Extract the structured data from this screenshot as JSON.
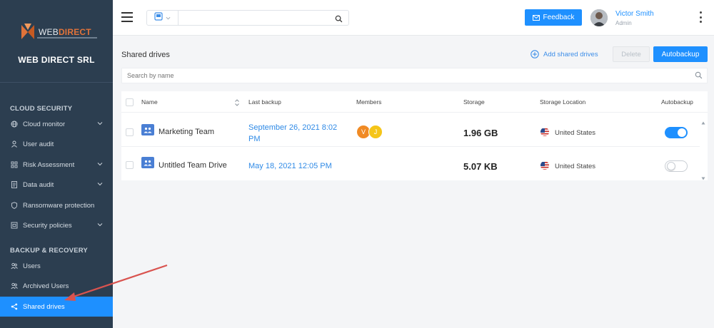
{
  "brand": {
    "logo_web": "WEB",
    "logo_direct": "DIRECT",
    "company_name": "WEB DIRECT SRL"
  },
  "sidebar": {
    "sections": [
      {
        "title": "CLOUD SECURITY"
      },
      {
        "title": "BACKUP & RECOVERY"
      }
    ],
    "items": [
      {
        "label": "Cloud monitor",
        "icon": "globe-icon",
        "has_chevron": true
      },
      {
        "label": "User audit",
        "icon": "user-icon",
        "has_chevron": false
      },
      {
        "label": "Risk Assessment",
        "icon": "grid-icon",
        "has_chevron": true
      },
      {
        "label": "Data audit",
        "icon": "document-icon",
        "has_chevron": true
      },
      {
        "label": "Ransomware protection",
        "icon": "shield-icon",
        "has_chevron": false
      },
      {
        "label": "Security policies",
        "icon": "policy-icon",
        "has_chevron": true
      },
      {
        "label": "Users",
        "icon": "users-icon",
        "has_chevron": false
      },
      {
        "label": "Archived Users",
        "icon": "archived-users-icon",
        "has_chevron": false
      },
      {
        "label": "Shared drives",
        "icon": "share-icon",
        "has_chevron": false,
        "active": true
      }
    ]
  },
  "topbar": {
    "search_placeholder": "",
    "feedback_label": "Feedback",
    "user_name": "Victor Smith",
    "user_role": "Admin"
  },
  "page": {
    "title": "Shared drives",
    "add_label": "Add shared drives",
    "delete_label": "Delete",
    "autobackup_label": "Autobackup",
    "search_placeholder": "Search by name"
  },
  "table": {
    "columns": [
      "Name",
      "Last backup",
      "Members",
      "Storage",
      "Storage Location",
      "Autobackup"
    ],
    "rows": [
      {
        "name": "Marketing Team",
        "last_backup_line1": "September 26, 2021 8:02",
        "last_backup_line2": "PM",
        "members": [
          {
            "initial": "V",
            "color": "#f08a24"
          },
          {
            "initial": "J",
            "color": "#f5c518"
          }
        ],
        "storage": "1.96 GB",
        "location": "United States",
        "autobackup": true
      },
      {
        "name": "Untitled Team Drive",
        "last_backup_line1": "May 18, 2021 12:05 PM",
        "last_backup_line2": "",
        "members": [],
        "storage": "5.07 KB",
        "location": "United States",
        "autobackup": false
      }
    ]
  },
  "colors": {
    "accent": "#1e90ff",
    "sidebar_bg": "#2c3e50",
    "annotation_arrow": "#d9534f"
  }
}
